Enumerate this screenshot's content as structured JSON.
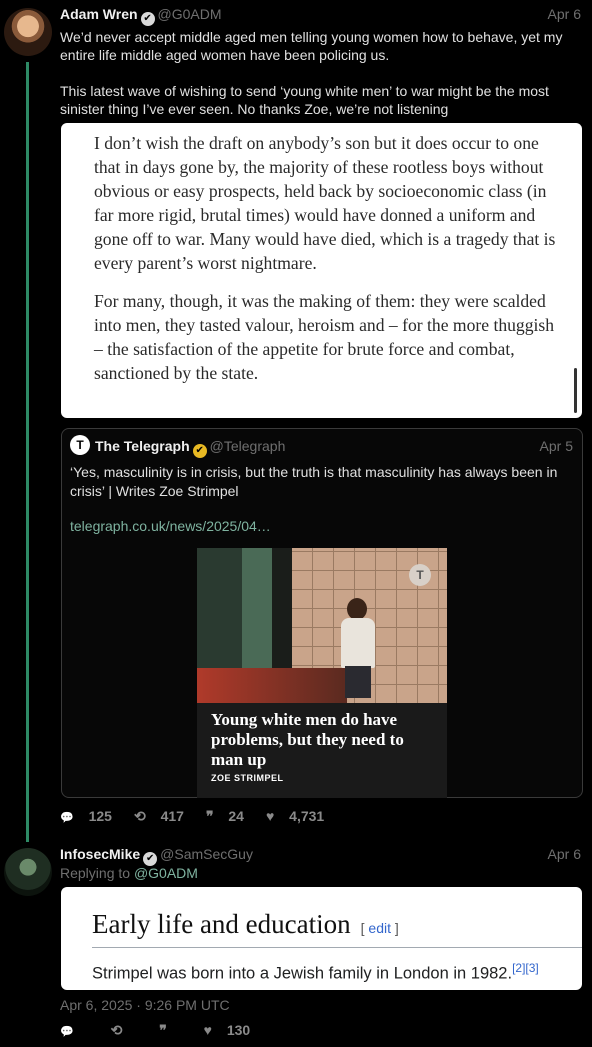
{
  "tweet1": {
    "name": "Adam Wren",
    "handle": "@G0ADM",
    "date": "Apr 6",
    "text1": "We’d never accept middle aged men telling young women how to behave, yet my entire life middle aged women have been policing us.",
    "text2": "This latest wave of wishing to send ‘young white men’ to war might be the most sinister thing I’ve ever seen. No thanks Zoe, we’re not listening",
    "image_para1": "I don’t wish the draft on anybody’s son but it does occur to one that in days gone by, the majority of these rootless boys without obvious or easy prospects, held back by socioeconomic class (in far more rigid, brutal times) would have donned a uniform and gone off to war. Many would have died, which is a tragedy that is every parent’s worst nightmare.",
    "image_para2": "For many, though, it was the making of them: they were scalded into men, they tasted valour, heroism and – for the more thuggish – the satisfaction of the appetite for brute force and combat, sanctioned by the state.",
    "quote": {
      "name": "The Telegraph",
      "handle": "@Telegraph",
      "date": "Apr 5",
      "text": "‘Yes, masculinity is in crisis, but the truth is that masculinity has always been in crisis’ | Writes Zoe Strimpel",
      "link": "telegraph.co.uk/news/2025/04…",
      "card_headline": "Young white men do have problems, but they need to man up",
      "card_byline": "ZOE STRIMPEL",
      "logo_glyph": "T"
    },
    "stats": {
      "replies": "125",
      "retweets": "417",
      "quotes": "24",
      "likes": "4,731"
    }
  },
  "tweet2": {
    "name": "InfosecMike",
    "handle": "@SamSecGuy",
    "date": "Apr 6",
    "replying_label": "Replying to",
    "replying_to": "@G0ADM",
    "wiki_heading": "Early life and education",
    "wiki_edit_open": "[",
    "wiki_edit": "edit",
    "wiki_edit_close": "]",
    "wiki_text": "Strimpel was born into a Jewish family in London in 1982.",
    "wiki_refs": "[2][3]",
    "timestamp": "Apr 6, 2025 · 9:26 PM UTC",
    "stats": {
      "replies": "",
      "retweets": "",
      "quotes": "",
      "likes": "130"
    }
  },
  "icons": {
    "verified": "✔",
    "reply": "💬",
    "retweet": "⟲",
    "quote": "❞",
    "like": "♥"
  },
  "colors": {
    "background": "#000000",
    "thread": "#2e8a66",
    "link": "#7fb3a0",
    "muted": "#6f6f6f"
  }
}
